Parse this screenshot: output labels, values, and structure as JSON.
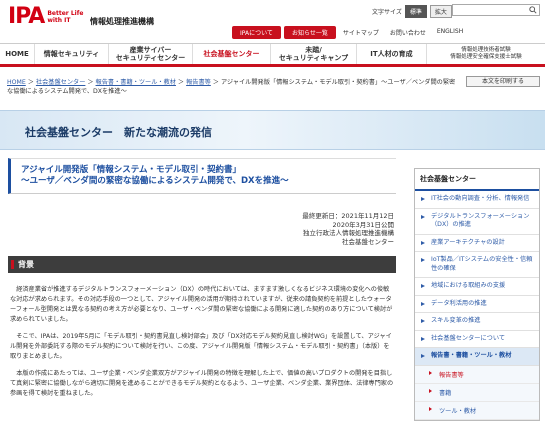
{
  "header": {
    "logo_text": "IPA",
    "logo_tagline_1": "Better Life",
    "logo_tagline_2": "with IT",
    "org_name": "情報処理推進機構",
    "text_size_label": "文字サイズ",
    "text_size_standard": "標準",
    "text_size_large": "拡大",
    "top_links": [
      "IPAについて",
      "お知らせ一覧",
      "サイトマップ",
      "お問い合わせ",
      "ENGLISH"
    ]
  },
  "gnav": {
    "items": [
      {
        "label": "HOME"
      },
      {
        "label": "情報セキュリティ"
      },
      {
        "label": "産業サイバー\nセキュリティセンター"
      },
      {
        "label": "社会基盤センター"
      },
      {
        "label": "未踏/\nセキュリティキャンプ"
      },
      {
        "label": "IT人材の育成"
      },
      {
        "label": "情報処理技術者試験\n情報処理安全確保支援士試験"
      }
    ]
  },
  "breadcrumb": {
    "items": [
      "HOME",
      "社会基盤センター",
      "報告書・書籍・ツール・教材",
      "報告書等"
    ],
    "current": "アジャイル開発版「情報システム・モデル取引・契約書」～ユーザ／ベンダ間の緊密な協働によるシステム開発で、DXを推進～",
    "print_label": "本文を印刷する"
  },
  "hero": {
    "title": "社会基盤センター　新たな潮流の発信"
  },
  "article": {
    "title_line1": "アジャイル開発版「情報システム・モデル取引・契約書」",
    "title_line2": "～ユーザ／ベンダ間の緊密な協働によるシステム開発で、DXを推進～",
    "updated": "最終更新日：2021年11月12日",
    "published": "2020年3月31日公開",
    "org": "独立行政法人情報処理推進機構",
    "dept": "社会基盤センター",
    "section_title": "背景",
    "paragraphs": [
      "経済産業省が推進するデジタルトランスフォーメーション（DX）の時代においては、ますます激しくなるビジネス環境の変化への俊敏な対応が求められます。その対応手段の一つとして、アジャイル開発の活用が期待されていますが、従来の請負契約を前提としたウォーターフォール型開発とは異なる契約の考え方が必要となり、ユーザ・ベンダ間の緊密な協働による開発に適した契約のあり方について検討が求められていました。",
      "そこで、IPAは、2019年5月に「モデル取引・契約書見直し検討部会」及び「DX対応モデル契約見直し検討WG」を設置して、アジャイル開発を外部委託する際のモデル契約について検討を行い、この度、アジャイル開発版「情報システム・モデル取引・契約書」（本版）を取りまとめました。",
      "本版の作成にあたっては、ユーザ企業・ベンダ企業双方がアジャイル開発の特徴を理解した上で、価値の高いプロダクトの開発を目指して真剣に緊密に協働しながら適切に開発を進めることができるモデル契約となるよう、ユーザ企業、ベンダ企業、業界団体、法律専門家の参画を得て検討を重ねました。"
    ]
  },
  "sidebar": {
    "heading": "社会基盤センター",
    "items": [
      {
        "label": "IT社会の動向調査・分析、情報発信"
      },
      {
        "label": "デジタルトランスフォーメーション（DX）の推進"
      },
      {
        "label": "産業アーキテクチャの設計"
      },
      {
        "label": "IoT製品／ITシステムの安全性・信頼性の確保"
      },
      {
        "label": "地域における取組みの支援"
      },
      {
        "label": "データ利活用の推進"
      },
      {
        "label": "スキル変革の推進"
      },
      {
        "label": "社会基盤センターについて"
      },
      {
        "label": "報告書・書籍・ツール・教材"
      }
    ],
    "subitems": [
      {
        "label": "報告書等"
      },
      {
        "label": "書籍"
      },
      {
        "label": "ツール・教材"
      }
    ]
  },
  "colors": {
    "brand_red": "#c8101e",
    "accent_blue": "#1d4fa0",
    "link_blue": "#2f5ca8"
  }
}
